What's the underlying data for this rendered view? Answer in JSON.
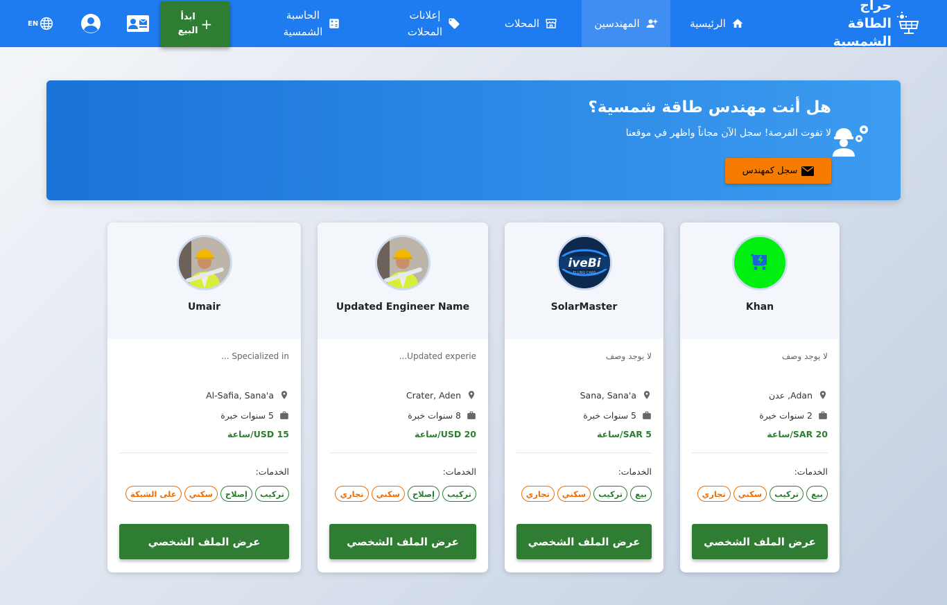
{
  "colors": {
    "nav": "#1e7cf0",
    "sell": "#2e7d32",
    "banner_btn": "#f57c00",
    "price": "#2e7d32"
  },
  "brand": {
    "line1": "حراج الطاقة",
    "line2": "الشمسية",
    "icon": "solar-panel-icon"
  },
  "nav": {
    "home": "الرئيسية",
    "engineers": "المهندسين",
    "shops": "المحلات",
    "shop_ads_1": "إعلانات",
    "shop_ads_2": "المحلات",
    "calculator_1": "الحاسبة",
    "calculator_2": "الشمسية",
    "sell_1": "ابدأ",
    "sell_2": "البيع",
    "lang": "EN"
  },
  "banner": {
    "title": "هل أنت مهندس طاقة شمسية؟",
    "subtitle": "لا تفوت الفرصة! سجل الآن مجاناً واظهر في موقعنا",
    "button": "سجل كمهندس"
  },
  "services_label": "الخدمات:",
  "profile_button": "عرض الملف الشخصي",
  "cards": [
    {
      "name": "Khan",
      "description": "لا يوجد وصف",
      "location": "Adan, عدن",
      "experience": "2 سنوات خبرة",
      "price": "20 SAR/ساعة",
      "avatar": "green-cart-logo",
      "tags": [
        {
          "label": "بيع",
          "tone": "green"
        },
        {
          "label": "تركيب",
          "tone": "green"
        },
        {
          "label": "سكني",
          "tone": "orange"
        },
        {
          "label": "تجاري",
          "tone": "orange"
        }
      ]
    },
    {
      "name": "SolarMaster",
      "description": "لا يوجد وصف",
      "location": "Sana, Sana'a",
      "experience": "5 سنوات خبرة",
      "price": "5 SAR/ساعة",
      "avatar": "drivebi-logo",
      "tags": [
        {
          "label": "بيع",
          "tone": "green"
        },
        {
          "label": "تركيب",
          "tone": "green"
        },
        {
          "label": "سكني",
          "tone": "orange"
        },
        {
          "label": "تجاري",
          "tone": "orange"
        }
      ]
    },
    {
      "name": "Updated Engineer Name",
      "description": "Updated experie...",
      "location": "Crater, Aden",
      "experience": "8 سنوات خبرة",
      "price": "20 USD/ساعة",
      "avatar": "engineer-photo",
      "tags": [
        {
          "label": "تركيب",
          "tone": "green"
        },
        {
          "label": "إصلاح",
          "tone": "green"
        },
        {
          "label": "سكني",
          "tone": "orange"
        },
        {
          "label": "تجاري",
          "tone": "orange"
        }
      ]
    },
    {
      "name": "Umair",
      "description": "Specialized in ...",
      "location": "Al-Safia, Sana'a",
      "experience": "5 سنوات خبرة",
      "price": "15 USD/ساعة",
      "avatar": "engineer-photo",
      "tags": [
        {
          "label": "تركيب",
          "tone": "green"
        },
        {
          "label": "إصلاح",
          "tone": "green"
        },
        {
          "label": "سكني",
          "tone": "orange"
        },
        {
          "label": "على الشبكة",
          "tone": "orange"
        }
      ]
    }
  ]
}
